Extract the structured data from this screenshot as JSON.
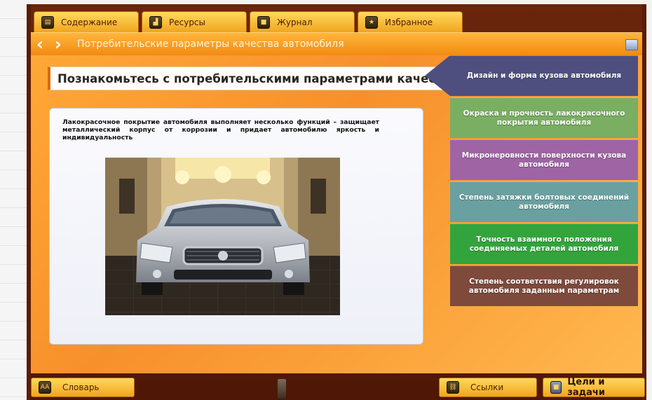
{
  "tabs": [
    {
      "label": "Содержание",
      "icon": "document-icon"
    },
    {
      "label": "Ресурсы",
      "icon": "resources-icon"
    },
    {
      "label": "Журнал",
      "icon": "journal-icon"
    },
    {
      "label": "Избранное",
      "icon": "star-icon"
    }
  ],
  "nav": {
    "back_icon": "chevron-left-icon",
    "forward_icon": "chevron-right-icon",
    "title": "Потребительские параметры качества автомобиля"
  },
  "main": {
    "heading": "Познакомьтесь с потребительскими параметрами качества автомобиля",
    "description": "Лакокрасочное покрытие автомобиля выполняет несколько функций – защищает металлический корпус от коррозии и придает автомобилю яркость и индивидуальность"
  },
  "menu": {
    "items": [
      {
        "label": "Дизайн и форма кузова автомобиля",
        "color": "#4e4f7e",
        "active": true
      },
      {
        "label": "Окраска и прочность лакокрасочного покрытия автомобиля",
        "color": "#7aae62"
      },
      {
        "label": "Микронеровности поверхности кузова автомобиля",
        "color": "#9e64a4"
      },
      {
        "label": "Степень затяжки болтовых соединений автомобиля",
        "color": "#6aa0a0"
      },
      {
        "label": "Точность взаимного положения соединяемых деталей автомобиля",
        "color": "#33a43c"
      },
      {
        "label": "Степень соответствия регулировок автомобиля заданным параметрам",
        "color": "#7e4a3c"
      }
    ]
  },
  "bottom": {
    "dictionary": "Словарь",
    "links": "Ссылки",
    "goals": "Цели и задачи"
  },
  "colors": {
    "accent_orange": "#f28a12",
    "frame_brown": "#5a1c08",
    "tab_yellow": "#ffd95c"
  }
}
